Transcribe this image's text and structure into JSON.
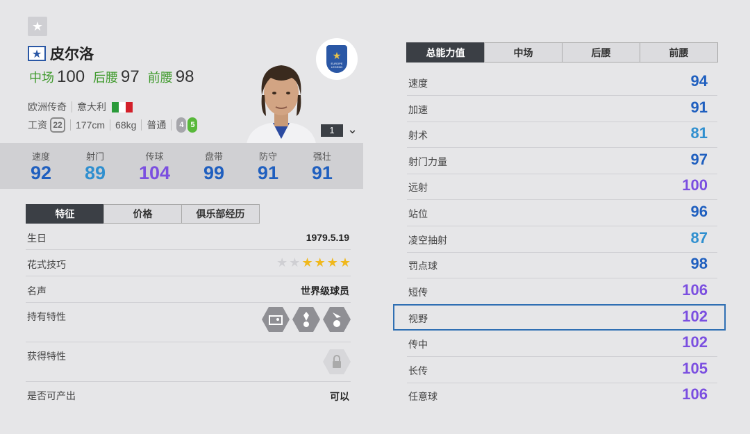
{
  "player": {
    "name": "皮尔洛",
    "positions": [
      {
        "label": "中场",
        "value": "100"
      },
      {
        "label": "后腰",
        "value": "97"
      },
      {
        "label": "前腰",
        "value": "98"
      }
    ],
    "season": "欧洲传奇",
    "nation": "意大利",
    "wage_label": "工资",
    "wage": "22",
    "height": "177cm",
    "weight": "68kg",
    "body_type": "普通",
    "weak_foot": "4",
    "strong_foot": "5",
    "upgrade_level": "1",
    "badge_text": "EUROPE LEGEND"
  },
  "colors": {
    "blue": "#1f5fbf",
    "light_blue": "#2f8fcf",
    "purple": "#7b4fe0",
    "green_label": "#3f9a2c"
  },
  "main_stats": [
    {
      "label": "速度",
      "value": "92",
      "color": "#1f5fbf"
    },
    {
      "label": "射门",
      "value": "89",
      "color": "#2f8fcf"
    },
    {
      "label": "传球",
      "value": "104",
      "color": "#7b4fe0"
    },
    {
      "label": "盘带",
      "value": "99",
      "color": "#1f5fbf"
    },
    {
      "label": "防守",
      "value": "91",
      "color": "#1f5fbf"
    },
    {
      "label": "强壮",
      "value": "91",
      "color": "#1f5fbf"
    }
  ],
  "left_tabs": [
    "特征",
    "价格",
    "俱乐部经历"
  ],
  "traits": {
    "birthday_label": "生日",
    "birthday": "1979.5.19",
    "skill_label": "花式技巧",
    "skill_stars": 4,
    "skill_stars_max": 6,
    "reputation_label": "名声",
    "reputation": "世界级球员",
    "owned_traits_label": "持有特性",
    "acquired_traits_label": "获得特性",
    "producible_label": "是否可产出",
    "producible": "可以"
  },
  "right_tabs": [
    "总能力值",
    "中场",
    "后腰",
    "前腰"
  ],
  "attributes": [
    {
      "label": "速度",
      "value": "94",
      "color": "#1f5fbf"
    },
    {
      "label": "加速",
      "value": "91",
      "color": "#1f5fbf"
    },
    {
      "label": "射术",
      "value": "81",
      "color": "#2f8fcf"
    },
    {
      "label": "射门力量",
      "value": "97",
      "color": "#1f5fbf"
    },
    {
      "label": "远射",
      "value": "100",
      "color": "#7b4fe0"
    },
    {
      "label": "站位",
      "value": "96",
      "color": "#1f5fbf"
    },
    {
      "label": "凌空抽射",
      "value": "87",
      "color": "#2f8fcf"
    },
    {
      "label": "罚点球",
      "value": "98",
      "color": "#1f5fbf"
    },
    {
      "label": "短传",
      "value": "106",
      "color": "#7b4fe0"
    },
    {
      "label": "视野",
      "value": "102",
      "color": "#7b4fe0"
    },
    {
      "label": "传中",
      "value": "102",
      "color": "#7b4fe0"
    },
    {
      "label": "长传",
      "value": "105",
      "color": "#7b4fe0"
    },
    {
      "label": "任意球",
      "value": "106",
      "color": "#7b4fe0"
    }
  ]
}
